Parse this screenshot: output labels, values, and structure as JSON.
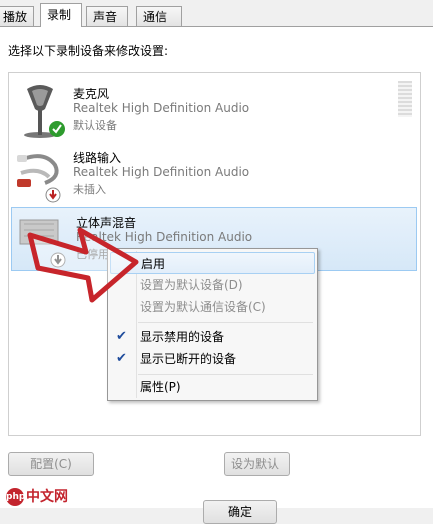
{
  "tabs": [
    {
      "label": "播放",
      "active": false
    },
    {
      "label": "录制",
      "active": true
    },
    {
      "label": "声音",
      "active": false
    },
    {
      "label": "通信",
      "active": false
    }
  ],
  "instruction": "选择以下录制设备来修改设置:",
  "devices": [
    {
      "name": "麦克风",
      "driver": "Realtek High Definition Audio",
      "status": "默认设备",
      "icon": "microphone-icon",
      "badge": "default-check-icon"
    },
    {
      "name": "线路输入",
      "driver": "Realtek High Definition Audio",
      "status": "未插入",
      "icon": "line-in-cable-icon",
      "badge": "unplugged-icon"
    },
    {
      "name": "立体声混音",
      "driver": "Realtek High Definition Audio",
      "status": "已停用",
      "icon": "stereo-mix-icon",
      "badge": "disabled-icon"
    }
  ],
  "context_menu": {
    "items": [
      {
        "label": "启用",
        "enabled": true,
        "checked": false
      },
      {
        "label": "设置为默认设备(D)",
        "enabled": false,
        "checked": false
      },
      {
        "label": "设置为默认通信设备(C)",
        "enabled": false,
        "checked": false
      },
      {
        "label": "显示禁用的设备",
        "enabled": true,
        "checked": true
      },
      {
        "label": "显示已断开的设备",
        "enabled": true,
        "checked": true
      },
      {
        "label": "属性(P)",
        "enabled": true,
        "checked": false
      }
    ]
  },
  "buttons": {
    "configure": "配置(C)",
    "set_default": "设为默认",
    "ok": "确定"
  },
  "watermark": {
    "logo": "php",
    "text": "中文网"
  },
  "colors": {
    "selection": "#d6e8f8",
    "arrow": "#c7252b",
    "check": "#2e9b2e"
  }
}
